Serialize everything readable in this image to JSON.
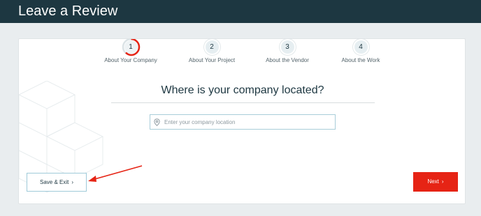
{
  "header": {
    "title": "Leave a Review"
  },
  "steps": [
    {
      "number": "1",
      "label": "About Your Company",
      "active": true
    },
    {
      "number": "2",
      "label": "About Your Project",
      "active": false
    },
    {
      "number": "3",
      "label": "About the Vendor",
      "active": false
    },
    {
      "number": "4",
      "label": "About the Work",
      "active": false
    }
  ],
  "question": "Where is your company located?",
  "location_field": {
    "placeholder": "Enter your company location",
    "value": ""
  },
  "buttons": {
    "save_exit": "Save & Exit",
    "next": "Next",
    "chevron": "›"
  },
  "colors": {
    "header_bg": "#1d3741",
    "accent_red": "#e62415",
    "field_border": "#a9cdd9"
  },
  "icons": {
    "location": "map-pin-icon",
    "annotation": "red-arrow-annotation"
  }
}
